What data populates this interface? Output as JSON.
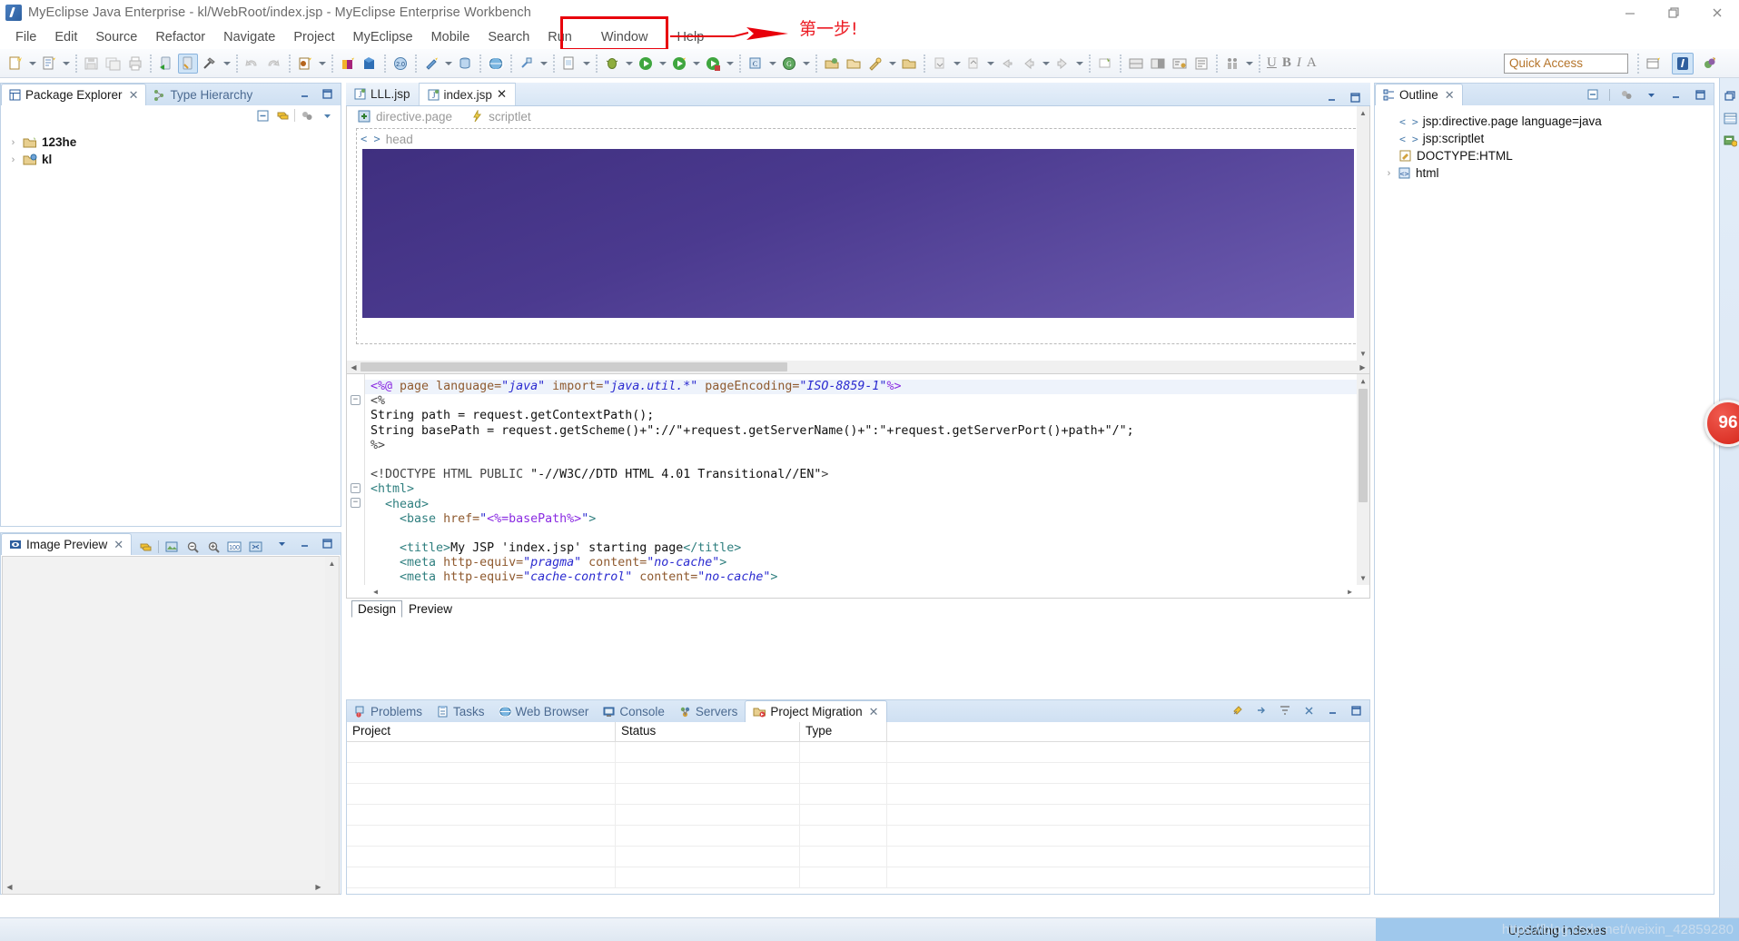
{
  "window": {
    "title": "MyEclipse Java Enterprise - kl/WebRoot/index.jsp - MyEclipse Enterprise Workbench",
    "app_icon": "myeclipse-icon",
    "controls": [
      {
        "name": "minimize-button",
        "glyph": "minimize-icon"
      },
      {
        "name": "restore-button",
        "glyph": "restore-icon"
      },
      {
        "name": "close-button",
        "glyph": "close-icon"
      }
    ]
  },
  "menubar": {
    "items": [
      {
        "label": "File"
      },
      {
        "label": "Edit"
      },
      {
        "label": "Source"
      },
      {
        "label": "Refactor"
      },
      {
        "label": "Navigate"
      },
      {
        "label": "Project"
      },
      {
        "label": "MyEclipse"
      },
      {
        "label": "Mobile"
      },
      {
        "label": "Search"
      },
      {
        "label": "Run"
      },
      {
        "label": "Window"
      },
      {
        "label": "Help"
      }
    ]
  },
  "annotation": {
    "highlight_target": "Window",
    "note_text": "第一步!",
    "color": "#ec1c24"
  },
  "toolbar": {
    "quick_access": {
      "placeholder": "Quick Access",
      "value": "Quick Access"
    },
    "perspective_buttons": [
      {
        "name": "open-perspective-button",
        "icon": "new-perspective-icon"
      },
      {
        "name": "perspective-java-enterprise",
        "icon": "java-enterprise-icon",
        "selected": true
      },
      {
        "name": "perspective-myeclipse",
        "icon": "myeclipse-perspective-icon",
        "selected": false
      }
    ]
  },
  "package_explorer": {
    "tabs": [
      {
        "label": "Package Explorer",
        "icon": "package-icon",
        "active": true,
        "closable": true
      },
      {
        "label": "Type Hierarchy",
        "icon": "hierarchy-icon",
        "active": false,
        "closable": false
      }
    ],
    "view_buttons": [
      {
        "name": "collapse-all-button",
        "icon": "collapse-all-icon"
      },
      {
        "name": "link-with-editor-button",
        "icon": "link-editor-icon"
      },
      {
        "name": "view-menu-filter-button",
        "icon": "filters-icon"
      },
      {
        "name": "view-menu-button",
        "icon": "chevron-down-icon"
      }
    ],
    "tree": [
      {
        "label": "123he",
        "icon": "project-folder-icon",
        "expandable": true
      },
      {
        "label": "kl",
        "icon": "web-project-icon",
        "expandable": true
      }
    ]
  },
  "image_preview": {
    "tab_label": "Image Preview",
    "tab_icon": "image-preview-icon",
    "toolbar_buttons": [
      {
        "name": "link-with-editor-button",
        "icon": "link-editor-icon"
      },
      {
        "name": "open-image-button",
        "icon": "open-image-icon"
      },
      {
        "name": "zoom-out-button",
        "icon": "zoom-out-icon"
      },
      {
        "name": "zoom-in-button",
        "icon": "zoom-in-icon"
      },
      {
        "name": "actual-size-button",
        "icon": "zoom-100-icon"
      },
      {
        "name": "fit-to-window-button",
        "icon": "fit-window-icon"
      },
      {
        "name": "view-menu-button",
        "icon": "chevron-down-icon"
      },
      {
        "name": "minimize-button",
        "icon": "minimize-icon"
      },
      {
        "name": "maximize-button",
        "icon": "maximize-icon"
      }
    ]
  },
  "editor": {
    "tabs": [
      {
        "label": "LLL.jsp",
        "icon": "jsp-file-icon",
        "active": false,
        "closable": false
      },
      {
        "label": "index.jsp",
        "icon": "jsp-file-icon",
        "active": true,
        "closable": true
      }
    ],
    "design_view": {
      "labels": [
        {
          "text": "directive.page",
          "icon": "directive-icon"
        },
        {
          "text": "scriptlet",
          "icon": "scriptlet-icon"
        },
        {
          "text": "head",
          "icon": "tag-icon"
        }
      ],
      "preview_gradient_from": "#3f2f7f",
      "preview_gradient_to": "#6d5cb0"
    },
    "mode_tabs": [
      {
        "label": "Design",
        "active": true
      },
      {
        "label": "Preview",
        "active": false
      }
    ],
    "code_lines": [
      "<%@ page language=\"java\" import=\"java.util.*\" pageEncoding=\"ISO-8859-1\"%>",
      "<%",
      "String path = request.getContextPath();",
      "String basePath = request.getScheme()+\"://\"+request.getServerName()+\":\"+request.getServerPort()+path+\"/\";",
      "%>",
      "",
      "<!DOCTYPE HTML PUBLIC \"-//W3C//DTD HTML 4.01 Transitional//EN\">",
      "<html>",
      "  <head>",
      "    <base href=\"<%=basePath%>\">",
      "",
      "    <title>My JSP 'index.jsp' starting page</title>",
      "    <meta http-equiv=\"pragma\" content=\"no-cache\">",
      "    <meta http-equiv=\"cache-control\" content=\"no-cache\">"
    ]
  },
  "bottom_panel": {
    "tabs": [
      {
        "label": "Problems",
        "icon": "problems-icon",
        "active": false,
        "closable": false
      },
      {
        "label": "Tasks",
        "icon": "tasks-icon",
        "active": false,
        "closable": false
      },
      {
        "label": "Web Browser",
        "icon": "web-browser-icon",
        "active": false,
        "closable": false
      },
      {
        "label": "Console",
        "icon": "console-icon",
        "active": false,
        "closable": false
      },
      {
        "label": "Servers",
        "icon": "servers-icon",
        "active": false,
        "closable": false
      },
      {
        "label": "Project Migration",
        "icon": "migration-icon",
        "active": true,
        "closable": true
      }
    ],
    "view_buttons": [
      {
        "name": "pin-button",
        "icon": "pin-icon"
      },
      {
        "name": "next-button",
        "icon": "arrow-right-icon"
      },
      {
        "name": "filters-button",
        "icon": "filters-icon"
      },
      {
        "name": "close-button",
        "icon": "close-icon"
      },
      {
        "name": "minimize-button",
        "icon": "minimize-icon"
      },
      {
        "name": "maximize-button",
        "icon": "maximize-icon"
      }
    ],
    "table": {
      "columns": [
        "Project",
        "Status",
        "Type"
      ],
      "rows": []
    }
  },
  "outline": {
    "tab_label": "Outline",
    "tab_icon": "outline-icon",
    "view_buttons": [
      {
        "name": "collapse-all-button",
        "icon": "collapse-all-icon"
      },
      {
        "name": "filters-button",
        "icon": "filters-icon"
      },
      {
        "name": "view-menu-button",
        "icon": "chevron-down-icon"
      },
      {
        "name": "minimize-button",
        "icon": "minimize-icon"
      },
      {
        "name": "maximize-button",
        "icon": "maximize-icon"
      }
    ],
    "items": [
      {
        "label": "jsp:directive.page language=java",
        "icon": "code-tag-icon",
        "expandable": false
      },
      {
        "label": "jsp:scriptlet",
        "icon": "code-tag-icon",
        "expandable": false
      },
      {
        "label": "DOCTYPE:HTML",
        "icon": "doctype-icon",
        "expandable": false
      },
      {
        "label": "html",
        "icon": "html-tag-icon",
        "expandable": true
      }
    ]
  },
  "right_rail": {
    "buttons": [
      {
        "name": "restore-button",
        "icon": "restore-icon"
      },
      {
        "name": "properties-view-button",
        "icon": "properties-icon"
      },
      {
        "name": "snippets-view-button",
        "icon": "snippets-icon"
      }
    ]
  },
  "statusbar": {
    "message": "Updating indexes",
    "watermark": "https://blog.csdn.net/weixin_42859280",
    "badge": "96"
  }
}
